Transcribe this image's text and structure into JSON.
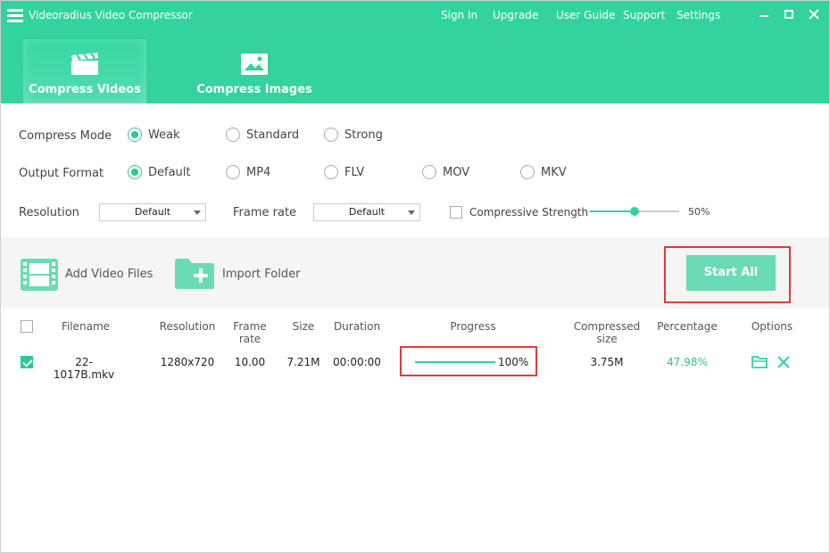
{
  "app": {
    "title": "Videoradius Video Compressor"
  },
  "topnav": {
    "sign_in": "Sign In",
    "upgrade": "Upgrade",
    "user_guide": "User Guide",
    "support": "Support",
    "settings": "Settings"
  },
  "tabs": [
    {
      "label": "Compress Videos",
      "icon": "clapperboard-icon",
      "active": true
    },
    {
      "label": "Compress Images",
      "icon": "image-icon",
      "active": false
    }
  ],
  "settings": {
    "compress_mode": {
      "label": "Compress Mode",
      "options": [
        "Weak",
        "Standard",
        "Strong"
      ],
      "selected": "Weak"
    },
    "output_format": {
      "label": "Output Format",
      "options": [
        "Default",
        "MP4",
        "FLV",
        "MOV",
        "MKV"
      ],
      "selected": "Default"
    },
    "resolution": {
      "label": "Resolution",
      "value": "Default"
    },
    "frame_rate": {
      "label": "Frame rate",
      "value": "Default"
    },
    "compressive_strength": {
      "label": "Compressive Strength",
      "checked": false,
      "value_text": "50%",
      "value": 0.5
    }
  },
  "actions": {
    "add_video_files": "Add Video Files",
    "import_folder": "Import Folder",
    "start_all": "Start All"
  },
  "table": {
    "headers": [
      "Filename",
      "Resolution",
      "Frame rate",
      "Size",
      "Duration",
      "Progress",
      "Compressed size",
      "Percentage",
      "Options"
    ],
    "rows": [
      {
        "checked": true,
        "filename": "22-1017B.mkv",
        "resolution": "1280x720",
        "frame_rate": "10.00",
        "size": "7.21M",
        "duration": "00:00:00",
        "progress_text": "100%",
        "progress": 1.0,
        "compressed_size": "3.75M",
        "percentage": "47.98%"
      }
    ]
  },
  "colors": {
    "accent": "#33d29e",
    "highlight": "#e03b3b"
  }
}
